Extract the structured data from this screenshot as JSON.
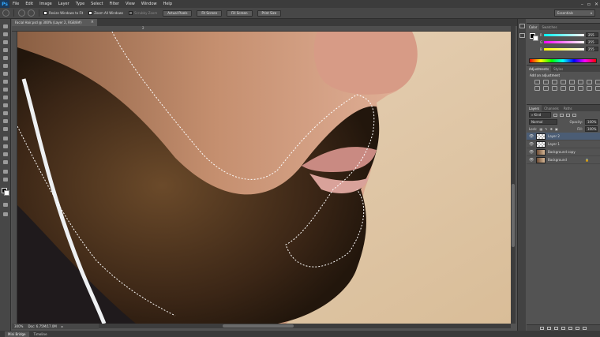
{
  "app": {
    "logo": "Ps"
  },
  "menu": [
    "File",
    "Edit",
    "Image",
    "Layer",
    "Type",
    "Select",
    "Filter",
    "View",
    "Window",
    "Help"
  ],
  "window_controls": [
    "–",
    "▫",
    "✕"
  ],
  "options_bar": {
    "checkboxes": [
      {
        "label": "Resize Windows to Fit",
        "enabled": true
      },
      {
        "label": "Zoom All Windows",
        "enabled": true
      },
      {
        "label": "Scrubby Zoom",
        "enabled": false
      }
    ],
    "buttons": [
      "Actual Pixels",
      "Fit Screen",
      "Fill Screen",
      "Print Size"
    ],
    "workspace": "Essentials"
  },
  "document": {
    "tab_title": "Facial Hair.psd @ 300% (Layer 2, RGB/8#)",
    "zoom": "300%",
    "doc_size": "Doc: 6.75M/17.0M"
  },
  "ruler_marks": [
    "2"
  ],
  "color_panel": {
    "tabs": [
      "Color",
      "Swatches"
    ],
    "channels": [
      {
        "label": "R",
        "value": "255",
        "gradient": "linear-gradient(90deg,#00ffff,#ffffff)"
      },
      {
        "label": "G",
        "value": "255",
        "gradient": "linear-gradient(90deg,#ff00ff,#ffffff)"
      },
      {
        "label": "B",
        "value": "255",
        "gradient": "linear-gradient(90deg,#ffff00,#ffffff)"
      }
    ]
  },
  "adjustments_panel": {
    "tabs": [
      "Adjustments",
      "Styles"
    ],
    "title": "Add an adjustment"
  },
  "layers_panel": {
    "tabs": [
      "Layers",
      "Channels",
      "Paths"
    ],
    "filter_kind": "Kind",
    "blend_mode": "Normal",
    "opacity_label": "Opacity:",
    "opacity": "100%",
    "lock_label": "Lock:",
    "fill_label": "Fill:",
    "fill": "100%",
    "layers": [
      {
        "name": "Layer 2",
        "selected": true,
        "thumb": "transparent",
        "locked": false
      },
      {
        "name": "Layer 1",
        "selected": false,
        "thumb": "transparent",
        "locked": false
      },
      {
        "name": "Background copy",
        "selected": false,
        "thumb": "photo",
        "locked": false
      },
      {
        "name": "Background",
        "selected": false,
        "thumb": "photo",
        "locked": true
      }
    ]
  },
  "bottom_tabs": [
    "Mini Bridge",
    "Timeline"
  ]
}
